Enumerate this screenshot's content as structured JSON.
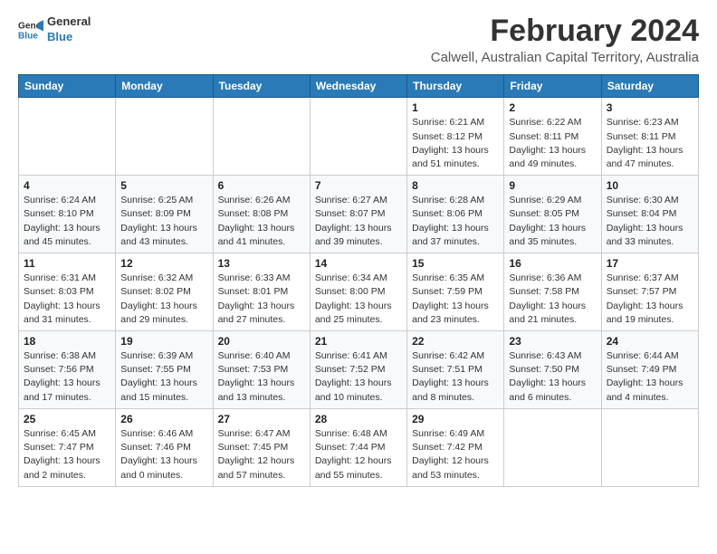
{
  "logo": {
    "line1": "General",
    "line2": "Blue"
  },
  "title": "February 2024",
  "subtitle": "Calwell, Australian Capital Territory, Australia",
  "days_header": [
    "Sunday",
    "Monday",
    "Tuesday",
    "Wednesday",
    "Thursday",
    "Friday",
    "Saturday"
  ],
  "weeks": [
    [
      {
        "num": "",
        "info": ""
      },
      {
        "num": "",
        "info": ""
      },
      {
        "num": "",
        "info": ""
      },
      {
        "num": "",
        "info": ""
      },
      {
        "num": "1",
        "info": "Sunrise: 6:21 AM\nSunset: 8:12 PM\nDaylight: 13 hours\nand 51 minutes."
      },
      {
        "num": "2",
        "info": "Sunrise: 6:22 AM\nSunset: 8:11 PM\nDaylight: 13 hours\nand 49 minutes."
      },
      {
        "num": "3",
        "info": "Sunrise: 6:23 AM\nSunset: 8:11 PM\nDaylight: 13 hours\nand 47 minutes."
      }
    ],
    [
      {
        "num": "4",
        "info": "Sunrise: 6:24 AM\nSunset: 8:10 PM\nDaylight: 13 hours\nand 45 minutes."
      },
      {
        "num": "5",
        "info": "Sunrise: 6:25 AM\nSunset: 8:09 PM\nDaylight: 13 hours\nand 43 minutes."
      },
      {
        "num": "6",
        "info": "Sunrise: 6:26 AM\nSunset: 8:08 PM\nDaylight: 13 hours\nand 41 minutes."
      },
      {
        "num": "7",
        "info": "Sunrise: 6:27 AM\nSunset: 8:07 PM\nDaylight: 13 hours\nand 39 minutes."
      },
      {
        "num": "8",
        "info": "Sunrise: 6:28 AM\nSunset: 8:06 PM\nDaylight: 13 hours\nand 37 minutes."
      },
      {
        "num": "9",
        "info": "Sunrise: 6:29 AM\nSunset: 8:05 PM\nDaylight: 13 hours\nand 35 minutes."
      },
      {
        "num": "10",
        "info": "Sunrise: 6:30 AM\nSunset: 8:04 PM\nDaylight: 13 hours\nand 33 minutes."
      }
    ],
    [
      {
        "num": "11",
        "info": "Sunrise: 6:31 AM\nSunset: 8:03 PM\nDaylight: 13 hours\nand 31 minutes."
      },
      {
        "num": "12",
        "info": "Sunrise: 6:32 AM\nSunset: 8:02 PM\nDaylight: 13 hours\nand 29 minutes."
      },
      {
        "num": "13",
        "info": "Sunrise: 6:33 AM\nSunset: 8:01 PM\nDaylight: 13 hours\nand 27 minutes."
      },
      {
        "num": "14",
        "info": "Sunrise: 6:34 AM\nSunset: 8:00 PM\nDaylight: 13 hours\nand 25 minutes."
      },
      {
        "num": "15",
        "info": "Sunrise: 6:35 AM\nSunset: 7:59 PM\nDaylight: 13 hours\nand 23 minutes."
      },
      {
        "num": "16",
        "info": "Sunrise: 6:36 AM\nSunset: 7:58 PM\nDaylight: 13 hours\nand 21 minutes."
      },
      {
        "num": "17",
        "info": "Sunrise: 6:37 AM\nSunset: 7:57 PM\nDaylight: 13 hours\nand 19 minutes."
      }
    ],
    [
      {
        "num": "18",
        "info": "Sunrise: 6:38 AM\nSunset: 7:56 PM\nDaylight: 13 hours\nand 17 minutes."
      },
      {
        "num": "19",
        "info": "Sunrise: 6:39 AM\nSunset: 7:55 PM\nDaylight: 13 hours\nand 15 minutes."
      },
      {
        "num": "20",
        "info": "Sunrise: 6:40 AM\nSunset: 7:53 PM\nDaylight: 13 hours\nand 13 minutes."
      },
      {
        "num": "21",
        "info": "Sunrise: 6:41 AM\nSunset: 7:52 PM\nDaylight: 13 hours\nand 10 minutes."
      },
      {
        "num": "22",
        "info": "Sunrise: 6:42 AM\nSunset: 7:51 PM\nDaylight: 13 hours\nand 8 minutes."
      },
      {
        "num": "23",
        "info": "Sunrise: 6:43 AM\nSunset: 7:50 PM\nDaylight: 13 hours\nand 6 minutes."
      },
      {
        "num": "24",
        "info": "Sunrise: 6:44 AM\nSunset: 7:49 PM\nDaylight: 13 hours\nand 4 minutes."
      }
    ],
    [
      {
        "num": "25",
        "info": "Sunrise: 6:45 AM\nSunset: 7:47 PM\nDaylight: 13 hours\nand 2 minutes."
      },
      {
        "num": "26",
        "info": "Sunrise: 6:46 AM\nSunset: 7:46 PM\nDaylight: 13 hours\nand 0 minutes."
      },
      {
        "num": "27",
        "info": "Sunrise: 6:47 AM\nSunset: 7:45 PM\nDaylight: 12 hours\nand 57 minutes."
      },
      {
        "num": "28",
        "info": "Sunrise: 6:48 AM\nSunset: 7:44 PM\nDaylight: 12 hours\nand 55 minutes."
      },
      {
        "num": "29",
        "info": "Sunrise: 6:49 AM\nSunset: 7:42 PM\nDaylight: 12 hours\nand 53 minutes."
      },
      {
        "num": "",
        "info": ""
      },
      {
        "num": "",
        "info": ""
      }
    ]
  ]
}
